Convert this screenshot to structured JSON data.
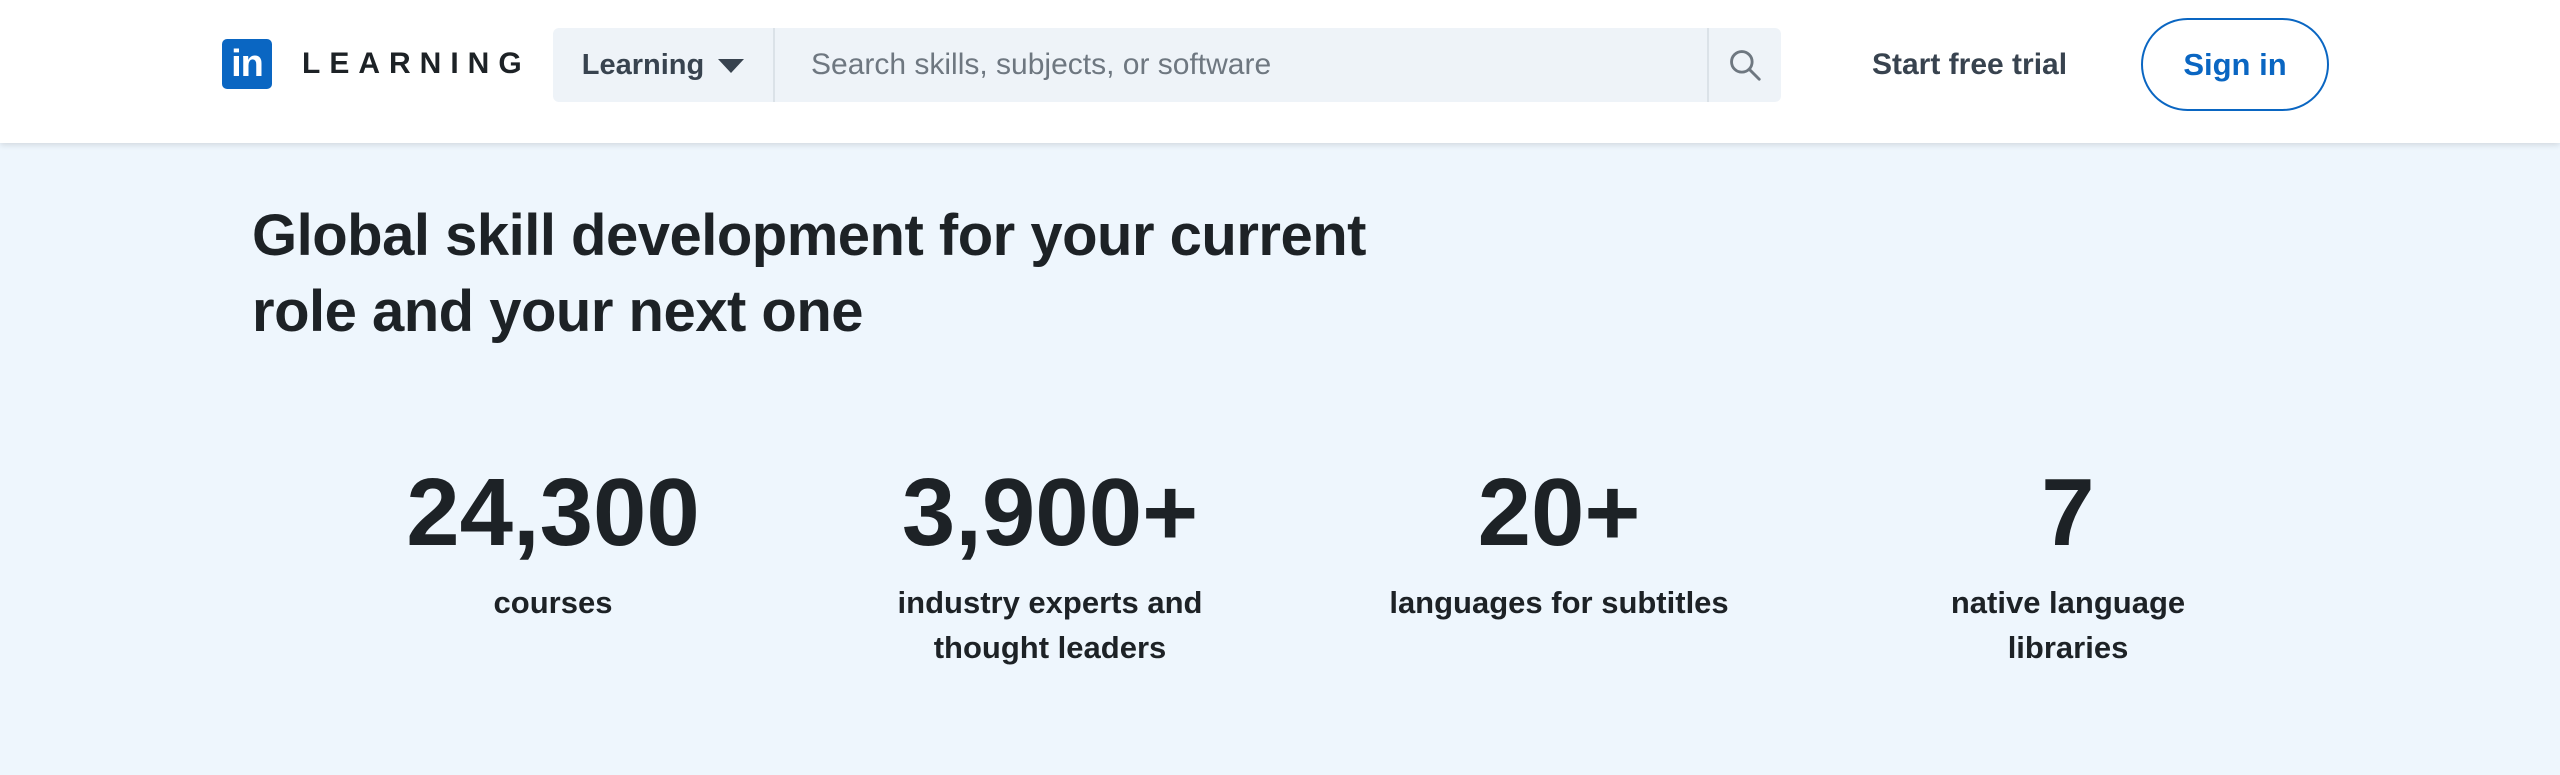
{
  "header": {
    "logo_badge": "in",
    "logo_text": "LEARNING",
    "search": {
      "scope_label": "Learning",
      "placeholder": "Search skills, subjects, or software",
      "value": ""
    },
    "start_trial_label": "Start free trial",
    "sign_in_label": "Sign in"
  },
  "hero": {
    "title_line1": "Global skill development for your current",
    "title_line2": "role and your next one"
  },
  "stats": [
    {
      "value": "24,300",
      "label_line1": "courses",
      "label_line2": ""
    },
    {
      "value": "3,900+",
      "label_line1": "industry experts and",
      "label_line2": "thought leaders"
    },
    {
      "value": "20+",
      "label_line1": "languages for subtitles",
      "label_line2": ""
    },
    {
      "value": "7",
      "label_line1": "native language",
      "label_line2": "libraries"
    }
  ],
  "icons": {
    "scope_caret": "caret-down-icon",
    "search": "search-icon"
  },
  "colors": {
    "brand": "#0a66c2",
    "page_background": "#eef6fd",
    "header_background": "#ffffff",
    "search_background": "#eef3f8",
    "text_primary": "#1d2226",
    "text_secondary": "#38434f"
  }
}
